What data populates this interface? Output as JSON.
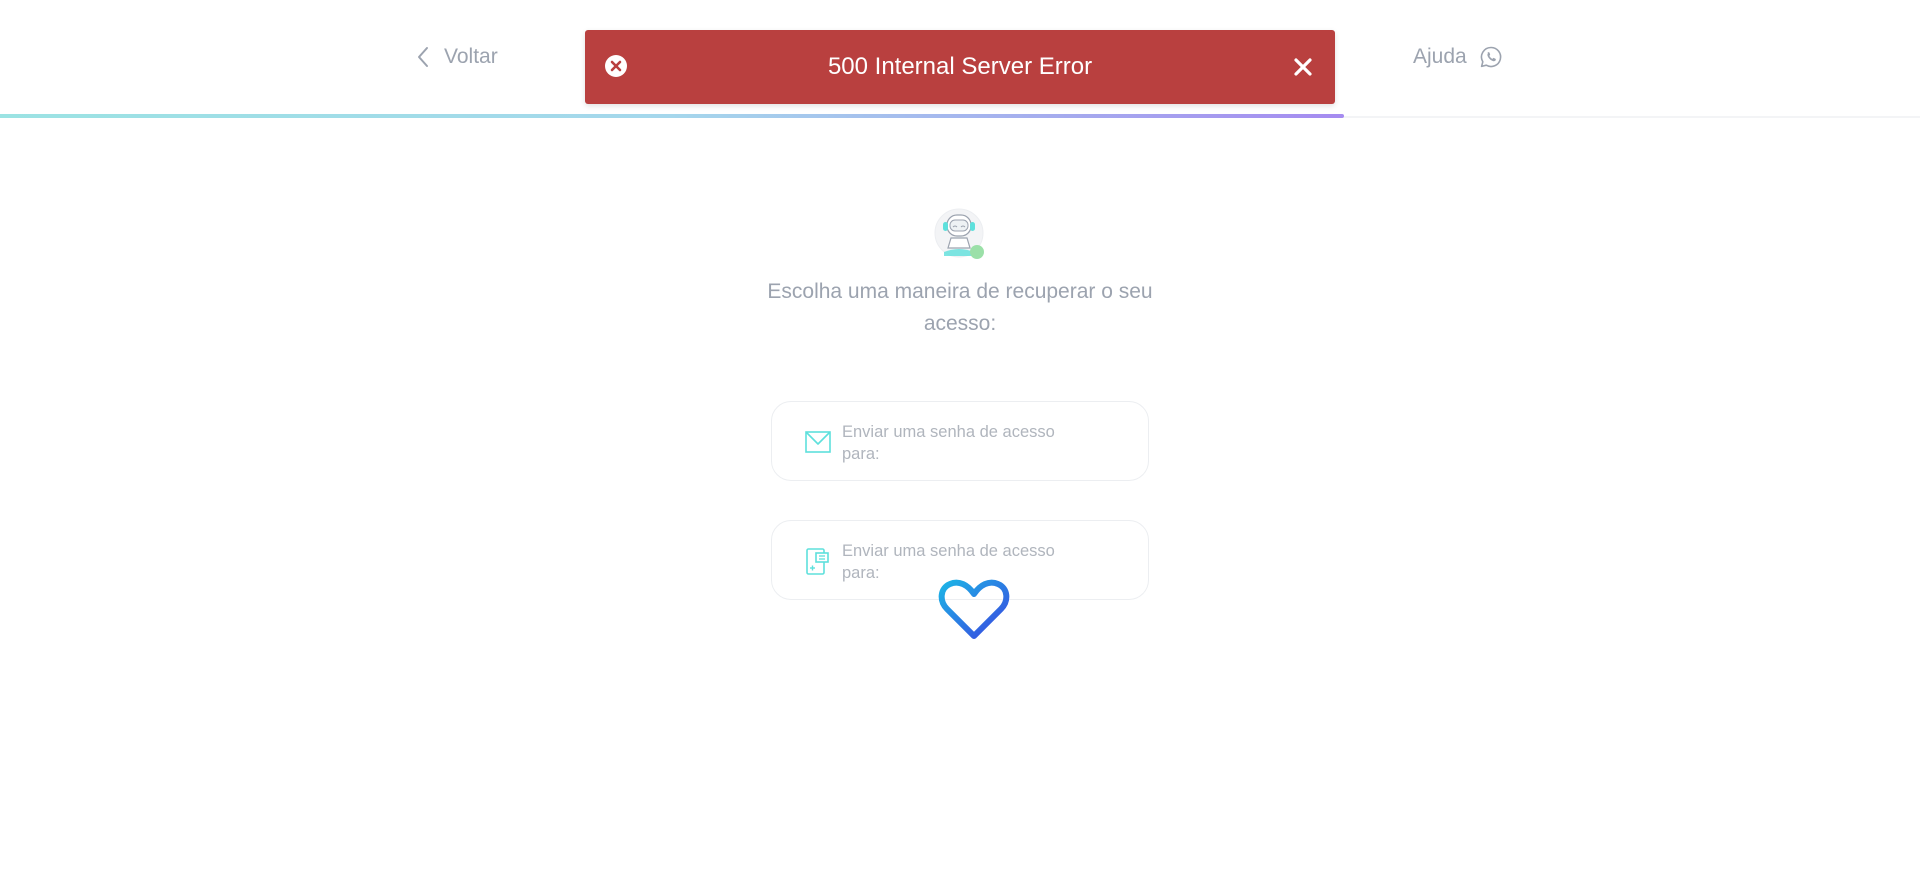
{
  "header": {
    "back_label": "Voltar",
    "help_label": "Ajuda"
  },
  "progress": {
    "fraction": 0.7
  },
  "toast": {
    "message": "500 Internal Server Error",
    "color": "#b9403f"
  },
  "main": {
    "heading": "Escolha uma maneira de recuperar o seu acesso:",
    "options": [
      {
        "icon": "envelope-icon",
        "label": "Enviar uma senha de acesso para:"
      },
      {
        "icon": "phone-icon",
        "label": "Enviar uma senha de acesso para:"
      }
    ]
  },
  "loader": {
    "icon": "heart-icon"
  },
  "colors": {
    "accent": "#5ee0dc",
    "text_muted": "#9ca3af",
    "loader_gradient_start": "#1cb4e6",
    "loader_gradient_end": "#3a46e0"
  }
}
